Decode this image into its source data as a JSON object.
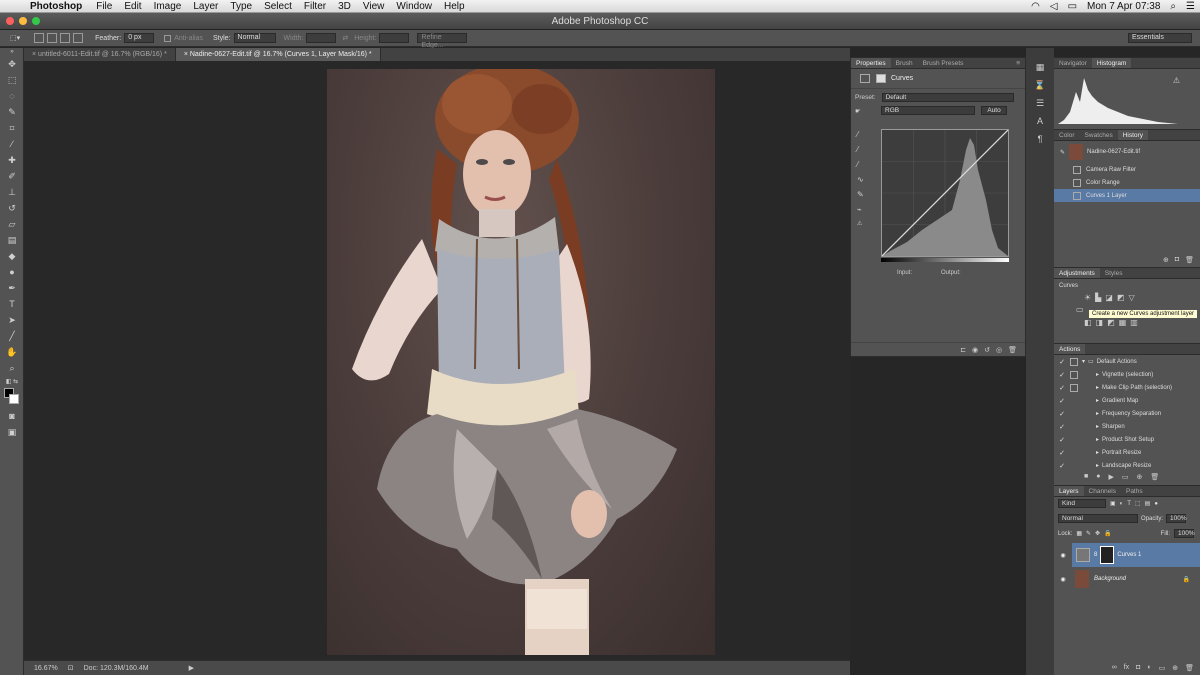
{
  "menubar": {
    "app_name": "Photoshop",
    "items": [
      "File",
      "Edit",
      "Image",
      "Layer",
      "Type",
      "Select",
      "Filter",
      "3D",
      "View",
      "Window",
      "Help"
    ],
    "clock": "Mon 7 Apr  07:38"
  },
  "window": {
    "title": "Adobe Photoshop CC"
  },
  "options_bar": {
    "feather_label": "Feather:",
    "feather_value": "0 px",
    "anti_alias_label": "Anti-alias",
    "style_label": "Style:",
    "style_value": "Normal",
    "width_label": "Width:",
    "height_label": "Height:",
    "refine_edge_label": "Refine Edge...",
    "workspace_value": "Essentials"
  },
  "tabs": [
    {
      "label": "untitled-6011-Edit.tif @ 16.7% (RGB/16) *"
    },
    {
      "label": "Nadine-0627-Edit.tif @ 16.7% (Curves 1, Layer Mask/16) *"
    }
  ],
  "status_bar": {
    "zoom": "16.67%",
    "doc": "Doc: 120.3M/160.4M"
  },
  "properties": {
    "tabs": [
      "Properties",
      "Brush",
      "Brush Presets"
    ],
    "type_label": "Curves",
    "preset_label": "Preset:",
    "preset_value": "Default",
    "channel_value": "RGB",
    "auto_label": "Auto",
    "input_label": "Input:",
    "output_label": "Output:"
  },
  "navigator_panel": {
    "tabs": [
      "Navigator",
      "Histogram"
    ]
  },
  "history_panel": {
    "tabs": [
      "Color",
      "Swatches",
      "History"
    ],
    "snapshot": "Nadine-0627-Edit.tif",
    "items": [
      "Camera Raw Filter",
      "Color Range",
      "Curves 1 Layer"
    ]
  },
  "adjustments_panel": {
    "tabs": [
      "Adjustments",
      "Styles"
    ],
    "section_label": "Curves",
    "tooltip": "Create a new Curves adjustment layer"
  },
  "actions_panel": {
    "tabs": [
      "Actions"
    ],
    "set_name": "Default Actions",
    "items": [
      "Vignette (selection)",
      "Make Clip Path (selection)",
      "Gradient Map",
      "Frequency Separation",
      "Sharpen",
      "Product Shot Setup",
      "Portrait Resize",
      "Landscape Resize"
    ]
  },
  "layers_panel": {
    "tabs": [
      "Layers",
      "Channels",
      "Paths"
    ],
    "filter_value": "Kind",
    "blend_mode": "Normal",
    "opacity_label": "Opacity:",
    "opacity_value": "100%",
    "lock_label": "Lock:",
    "fill_label": "Fill:",
    "fill_value": "100%",
    "layers": [
      {
        "name": "Curves 1"
      },
      {
        "name": "Background"
      }
    ]
  },
  "colors": {
    "accent_selected": "#5a7aa6",
    "panel_bg": "#535353",
    "canvas_bg": "#282828"
  }
}
